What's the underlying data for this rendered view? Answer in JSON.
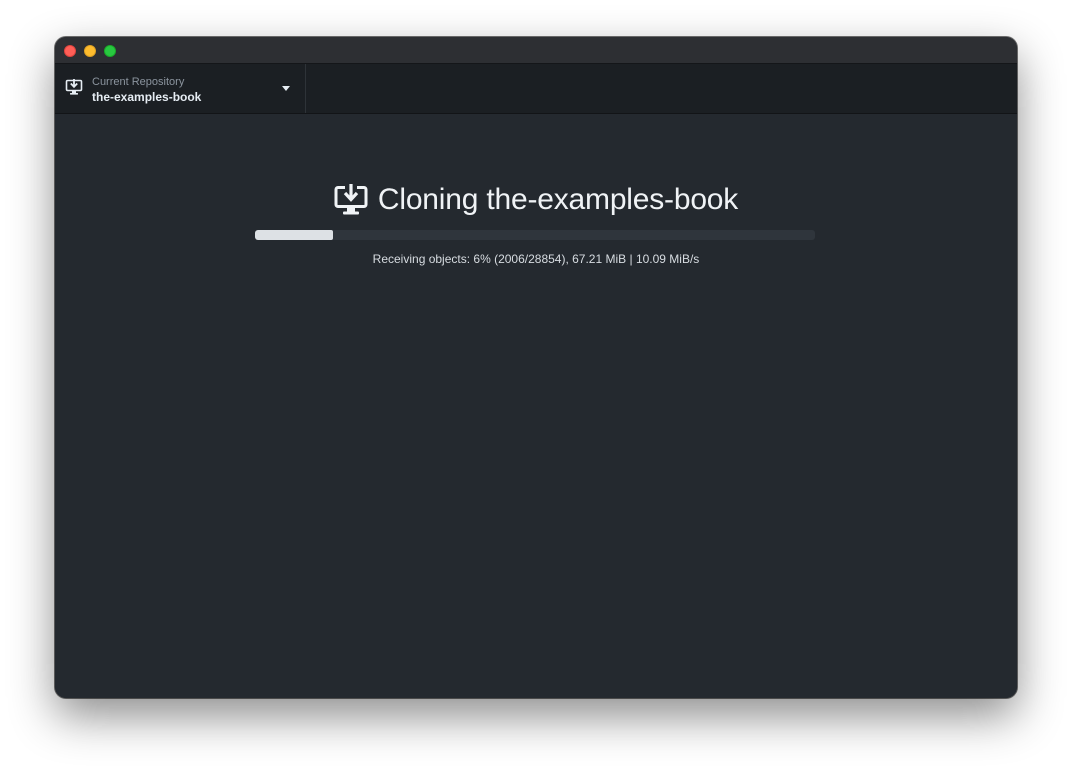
{
  "repository": {
    "caption": "Current Repository",
    "name": "the-examples-book",
    "icon": "desktop-download-icon"
  },
  "clone": {
    "title": "Cloning the-examples-book",
    "icon": "desktop-download-icon",
    "progress_percent": 14,
    "status_text": "Receiving objects: 6% (2006/28854), 67.21 MiB | 10.09 MiB/s"
  },
  "colors": {
    "window_background": "#24292f",
    "toolbar_background": "#1b1f23",
    "progress_fill": "#dde1e5",
    "progress_track": "#2f353c"
  }
}
